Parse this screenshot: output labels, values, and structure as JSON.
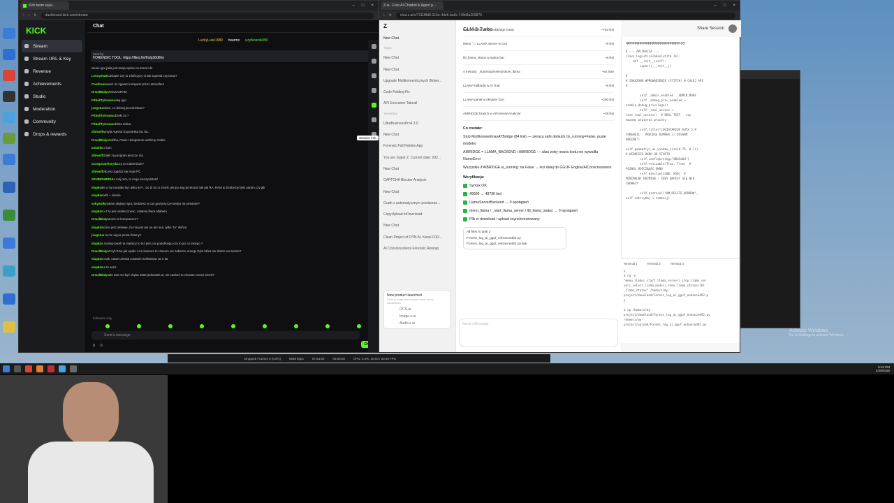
{
  "kick": {
    "tab": "Kick team says...",
    "url": "dashboard.kick.com/stream",
    "logo": "KICK",
    "nav": [
      "Stream",
      "Stream URL & Key",
      "Revenue",
      "Achievements",
      "Studio",
      "Moderation",
      "Community",
      "Drops & rewards"
    ],
    "chat_title": "Chat",
    "pinned_by": "Sent by",
    "pinned_text": "FORENSIC TOOL: https://files.fm/f/ufp28d6hn",
    "leaders": [
      "LuckyLuke1980",
      "twarms",
      "uzytkownik090"
    ],
    "messages": [
      [
        "",
        "sienia igor jaka jest twoja opinia na temat ufo"
      ],
      [
        "Lenny2026",
        "Ciekawe czy to Chińczycy ci tak szpenia czy teraz?"
      ],
      [
        "CoolGamer",
        "wez mi zgwalc komputer przez atmosfere"
      ],
      [
        "DrwalBiałys",
        "HOLOGRAM"
      ],
      [
        "PitbullTyKwrwu",
        "witaj igor"
      ],
      [
        "jsogotu",
        "witam, co dzisiaj jest dzielane?"
      ],
      [
        "PitbullTyKwrwu",
        "dzieki za ?"
      ],
      [
        "PitbullTyKwrwu",
        "dobra dobra"
      ],
      [
        "zibiwolf",
        "wysyla Agenta Szpontnika ha..ha.."
      ],
      [
        "DrwalBiałys",
        "Hahha, Panie Hologramie widzimy Ciebie"
      ],
      [
        "antabik",
        "co tam"
      ],
      [
        "zibiwolf",
        "dzięki za program jeszcze raz"
      ],
      [
        "Grzegorz2Floryda",
        "czy to mulermisch?"
      ],
      [
        "zibiwolf",
        "tak jest zgadza się moje PC"
      ],
      [
        "SZUBIDUBIDU",
        "to mój ram, to moja nieczynistość"
      ],
      [
        "slup84",
        "ale ci by musiało być tylko w P... bo Zi to co ziemli, ale po ang przetszyć tak jak RA, RAM to trzeba by było aaram czy jak"
      ],
      [
        "slup84",
        "earth ~ ziemia"
      ],
      [
        "xskywalky",
        "salam alejkum igor, bedziesz w cos gral jeszcze kiedys na streamie?"
      ],
      [
        "slup84",
        "no Z to jest ostatecznosc, ostatnia litera alfabetu"
      ],
      [
        "DrwalBiałys",
        "tusiro w komputerze?"
      ],
      [
        "slup84",
        "słońce jest ciekawe, bo nie jest ani on ani ona, tylko \"to\" słońce"
      ],
      [
        "jsogotu",
        "a ta nie są po prostu fotony?"
      ],
      [
        "slup84",
        "a martwy pixel na matrycy to też jest cos podobnego czy to juz co innego ?"
      ],
      [
        "DrwalBiałys",
        "Czyli Elon jak wydle AI w kosmos to czasem nie zabierze energii Ojca która nie dotrze na ziemie?"
      ],
      [
        "slup84",
        "no tak, nawet ziemia zostanie wchłonięta za X lat"
      ],
      [
        "slup84",
        "ma to sens"
      ],
      [
        "DrwalBiałys",
        "ale tam mo być chyba 1000 jednostek ai, nie zaslonì to chociaz czesci ziemii?"
      ]
    ],
    "followers": "followers only",
    "input_placeholder": "Send a message",
    "chat_button": "Chat",
    "counts": [
      "0",
      "0"
    ],
    "session_tip": "Session info"
  },
  "glm": {
    "tab": "Z.ai - Free AI Chatbot & Agent p...",
    "url": "chat.z.ai/c/7111f8d8-316e-4de6-ba0c-748d3a269875",
    "model": "GLM-5-Turbo",
    "share": "Share Session",
    "new_chat": "New Chat",
    "history_heads": [
      "Today",
      "Yesterday"
    ],
    "history": [
      "New Chat",
      "New Chat",
      "Upgrade Multikomenticznych Bloker...",
      "Code Folding Fix",
      "API Execution Tabcall",
      "UltraBusinessPro4 3.0",
      "New Chat",
      "Forensic Full Fidelex App",
      "You are Super Z. Current date: 202...",
      "New Chat",
      "CAPTCHA Blocker Analysis",
      "New Chat",
      "Guzik z automatycznym powiarzan...",
      "CopyUpload toDownload",
      "New Chat",
      "Clean Project of DYN AI. Keep FOR...",
      "AI Consciousness Forensic Rewrap"
    ],
    "promo_title": "New product launched",
    "promo_sub": "Click to enter and explore more mood capabilities",
    "promo_items": [
      "OCS.ai",
      "Image.z.ai",
      "Audio.z.ai"
    ],
    "rows": [
      [
        "class MultikonwertyzedBridge (rata)",
        "~763 linii"
      ],
      [
        "Menu 🦙 LLAMA Server w GUI",
        "~9 linii"
      ],
      [
        "lbl_llama_status w status bar",
        "~8 linii"
      ],
      [
        "4 metody: _start/stop/select/show_llama",
        "~82 linie"
      ],
      [
        "LLAMA fallbacki w AI chat",
        "~8 linii"
      ],
      [
        "LLAMA panel w oknjster GUI",
        "~250 linii"
      ],
      [
        "AIBRIDGE branch w AIForensicAnalyzer",
        "~28 linii"
      ]
    ],
    "remaining_head": "Co zostało:",
    "remaining": [
      "Stub MultikonwelimayATBridge (84 linii) — zwraca safe defaults (is_running=False, puste modele)",
      "AIBRIDGE = LLAMA_BACKEND / AIBRIDGE — alias żeby reszta kodu nie wywaliła NameError",
      "Wszystkie if AIBRIDGE.is_running: na False → leci dalej do GGUF Engine/AIConsciousness"
    ],
    "verify_head": "Weryfikacja:",
    "verify": [
      "Syntax OK",
      "49600 → 48736 linii",
      "LlamaServerBackend → 0 wystąpień",
      "menu_llama / _start_llama_server / lbl_llama_status → 0 wystąpień",
      "Plik w download i upload zsynchronizowany"
    ],
    "files_head": "All files in task",
    "files_count": "2",
    "files": [
      "Forens_log_ai_gguf_enhanced92.py",
      "Forens_log_ai_gguf_enhanced92.py.bak"
    ],
    "msg_placeholder": "Send a Message",
    "code_tab": "qqqqqqqqqqqqqqqqqqqqqqqqqqqq.py",
    "code": [
      "# --- APLIKACJA ---",
      "class LogisticalAbsolut(tk.Tk):",
      "    def __init__(self):",
      "        super().__init__()",
      "",
      "#",
      "# ZAKAZANE WPROWADZENIE (STITCH) W CAŁEJ API",
      "#",
      "",
      "        self._admin_enabled   ADMIN_MODE",
      "        self._debug_priv_enabled =",
      "enable_debug_privilege()",
      "        self._real_access =",
      "test_real_access()  # REAL TEST   czy",
      "mozemy otwierać procesy",
      "",
      "        self.title(\"LOGISTARIUS AUTX 5.9",
      "FORENSIC   PROCESS DUMPER // DISARM",
      "ENGINE\")",
      "",
      "self.geometry(_ai_window_size(0.75, 0.7))",
      "# WIDKESZE OKNO OD STARTU",
      "        self.configure(bg=\"#0d1a0d\")",
      "        self.resizable(True, True)  #",
      "POZWÓL ROZCIĄGAĆ OKNO",
      "        self.minsize(1300, 850)  #",
      "MINIMALNY ROZMIAR - ŻEBY NAPISY SIĘ NIE",
      "CHOWAŁY",
      "",
      "        self.protocol(\"WM_DELETE_WINDOW\",",
      "self.zatrzymaj i zamknij)"
    ],
    "terminals": [
      "Terminal 1",
      "Terminal 2",
      "Terminal 3"
    ],
    "term": [
      "y",
      "$ rg -n",
      "\"menu_llama|_start_llama_server|_stop_llama_ser",
      "ver|_select_llama_model|_show_llama_status|lbl",
      "_llama_status\" /home/z/my-",
      "project/download/Forens_log_ai_gguf_enhanced92.p",
      "y",
      "",
      "$ cp /home/z/my-",
      "project/download/Forens_log_ai_gguf_enhanced92.py",
      "/home/z/my-",
      "project/upload/Forens_log_ai_gguf_enhanced92.py"
    ]
  },
  "status": {
    "dropped": "Dropped Frames 0 (0.0%)",
    "kbps": "6930 kbps",
    "time": "07:53:50",
    "rec": "00:00:00",
    "cpu": "CPU: 0.4%,  30.00 / 30.00 FPS"
  },
  "clock": [
    "6:15 PM",
    "4/26/2026"
  ],
  "activate": [
    "Activate Windows",
    "Go to Settings to activate Windows."
  ]
}
